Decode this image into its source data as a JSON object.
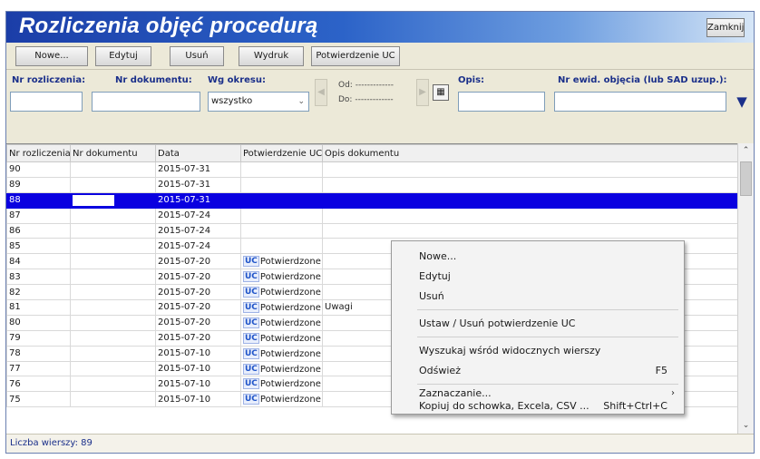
{
  "window": {
    "title": "Rozliczenia objęć procedurą",
    "close_label": "Zamknij"
  },
  "toolbar": {
    "new": "Nowe...",
    "edit": "Edytuj",
    "delete": "Usuń",
    "print": "Wydruk",
    "confirm_uc": "Potwierdzenie UC"
  },
  "filters": {
    "nr_rozliczenia_label": "Nr rozliczenia:",
    "nr_dokumentu_label": "Nr dokumentu:",
    "period_label": "Wg okresu:",
    "period_value": "wszystko",
    "od_label": "Od:",
    "od_value": "-------------",
    "do_label": "Do:",
    "do_value": "-------------",
    "opis_label": "Opis:",
    "nr_ewid_label": "Nr ewid. objęcia (lub SAD uzup.):"
  },
  "table": {
    "columns": [
      "Nr rozliczenia",
      "Nr dokumentu",
      "Data",
      "Potwierdzenie UC",
      "Opis dokumentu"
    ],
    "rows": [
      {
        "nr": "90",
        "doc": "",
        "date": "2015-07-31",
        "uc": "",
        "opis": ""
      },
      {
        "nr": "89",
        "doc": "",
        "date": "2015-07-31",
        "uc": "",
        "opis": ""
      },
      {
        "nr": "88",
        "doc": "",
        "date": "2015-07-31",
        "uc": "",
        "opis": ""
      },
      {
        "nr": "87",
        "doc": "",
        "date": "2015-07-24",
        "uc": "",
        "opis": ""
      },
      {
        "nr": "86",
        "doc": "",
        "date": "2015-07-24",
        "uc": "",
        "opis": ""
      },
      {
        "nr": "85",
        "doc": "",
        "date": "2015-07-24",
        "uc": "",
        "opis": ""
      },
      {
        "nr": "84",
        "doc": "",
        "date": "2015-07-20",
        "uc": "Potwierdzone",
        "opis": ""
      },
      {
        "nr": "83",
        "doc": "",
        "date": "2015-07-20",
        "uc": "Potwierdzone",
        "opis": ""
      },
      {
        "nr": "82",
        "doc": "",
        "date": "2015-07-20",
        "uc": "Potwierdzone",
        "opis": ""
      },
      {
        "nr": "81",
        "doc": "",
        "date": "2015-07-20",
        "uc": "Potwierdzone",
        "opis": "Uwagi"
      },
      {
        "nr": "80",
        "doc": "",
        "date": "2015-07-20",
        "uc": "Potwierdzone",
        "opis": ""
      },
      {
        "nr": "79",
        "doc": "",
        "date": "2015-07-20",
        "uc": "Potwierdzone",
        "opis": ""
      },
      {
        "nr": "78",
        "doc": "",
        "date": "2015-07-10",
        "uc": "Potwierdzone",
        "opis": ""
      },
      {
        "nr": "77",
        "doc": "",
        "date": "2015-07-10",
        "uc": "Potwierdzone",
        "opis": ""
      },
      {
        "nr": "76",
        "doc": "",
        "date": "2015-07-10",
        "uc": "Potwierdzone",
        "opis": ""
      },
      {
        "nr": "75",
        "doc": "",
        "date": "2015-07-10",
        "uc": "Potwierdzone",
        "opis": ""
      }
    ],
    "selected_row": "88",
    "uc_badge": "UC"
  },
  "status": {
    "row_count": "Liczba wierszy: 89"
  },
  "context_menu": {
    "new": "Nowe...",
    "edit": "Edytuj",
    "delete": "Usuń",
    "toggle_uc": "Ustaw / Usuń potwierdzenie UC",
    "search_visible": "Wyszukaj wśród widocznych wierszy",
    "refresh": "Odśwież",
    "refresh_shortcut": "F5",
    "selection": "Zaznaczanie...",
    "copy": "Kopiuj do schowka, Excela, CSV ...",
    "copy_shortcut": "Shift+Ctrl+C"
  },
  "colors": {
    "title_bar": "#1b3ea8",
    "selection": "#0a00e0",
    "label": "#1a2f8a"
  }
}
